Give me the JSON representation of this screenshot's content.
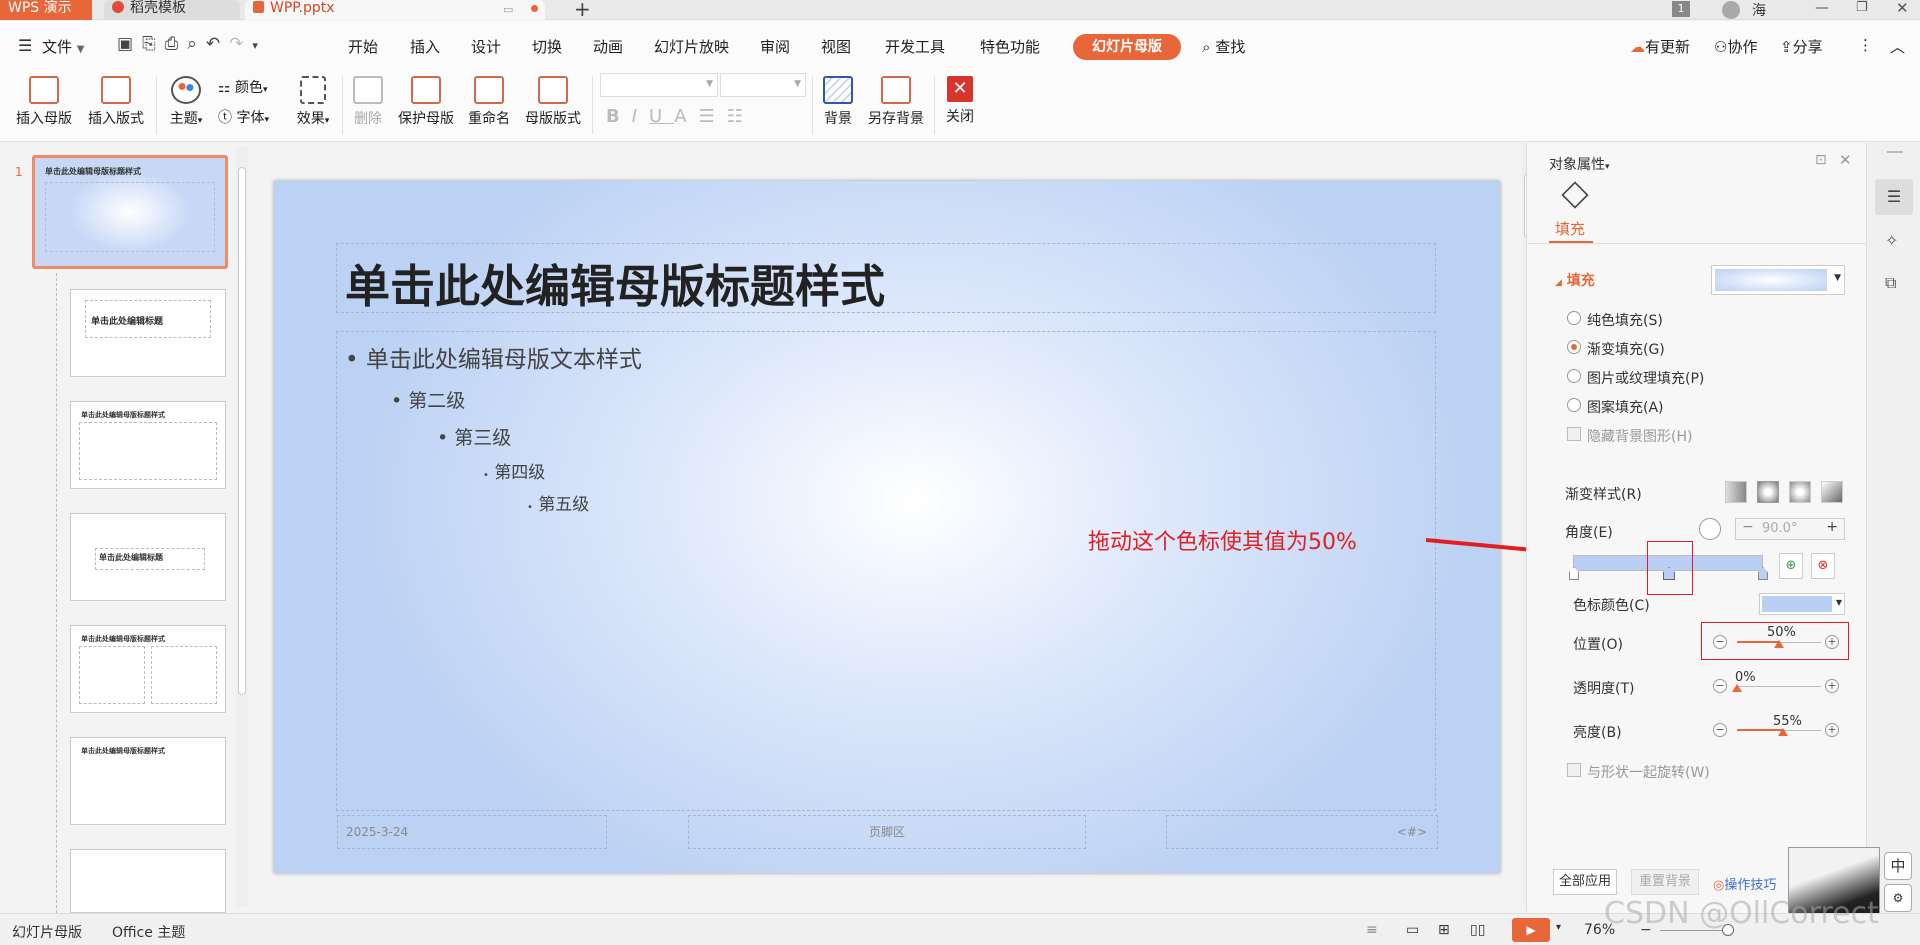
{
  "titlebar": {
    "app_tab": "WPS 演示",
    "template_tab": "稻壳模板",
    "file_tab": "WPP.pptx",
    "user_badge": "1",
    "user_name": "海"
  },
  "menu": {
    "file": "文件",
    "items": [
      "开始",
      "插入",
      "设计",
      "切换",
      "动画",
      "幻灯片放映",
      "审阅",
      "视图",
      "开发工具",
      "特色功能"
    ],
    "active_tab": "幻灯片母版",
    "search": "查找",
    "update": "有更新",
    "collab": "协作",
    "share": "分享"
  },
  "ribbon": {
    "insert_master": "插入母版",
    "insert_layout": "插入版式",
    "theme": "主题",
    "color": "颜色",
    "font": "字体",
    "effect": "效果",
    "delete": "删除",
    "protect_master": "保护母版",
    "rename": "重命名",
    "master_layout": "母版版式",
    "background": "背景",
    "save_background": "另存背景",
    "close": "关闭"
  },
  "thumbnails": {
    "slide_number": "1",
    "master_title": "单击此处编辑母版标题样式",
    "layout_title": "单击此处编辑标题"
  },
  "slide": {
    "title": "单击此处编辑母版标题样式",
    "levels": [
      "单击此处编辑母版文本样式",
      "第二级",
      "第三级",
      "第四级",
      "第五级"
    ],
    "footer_date": "2025-3-24",
    "footer_mid": "页脚区",
    "footer_num": "<#>"
  },
  "annotation": "拖动这个色标使其值为50%",
  "properties": {
    "header": "对象属性",
    "tab_fill": "填充",
    "section_fill": "填充",
    "solid": "纯色填充(S)",
    "gradient": "渐变填充(G)",
    "picture": "图片或纹理填充(P)",
    "pattern": "图案填充(A)",
    "hide_bg": "隐藏背景图形(H)",
    "gradient_style": "渐变样式(R)",
    "angle_label": "角度(E)",
    "angle_value": "90.0°",
    "stop_color_label": "色标颜色(C)",
    "position_label": "位置(O)",
    "position_value": "50%",
    "position_level": 0.5,
    "transparency_label": "透明度(T)",
    "transparency_value": "0%",
    "transparency_level": 0.0,
    "brightness_label": "亮度(B)",
    "brightness_value": "55%",
    "brightness_level": 0.55,
    "rotate_with_shape": "与形状一起旋转(W)",
    "apply_all": "全部应用",
    "reset_bg": "重置背景",
    "tips": "操作技巧",
    "accent": "#e8673a",
    "gradient_color": "#b9cff3"
  },
  "status": {
    "view_mode": "幻灯片母版",
    "theme": "Office 主题",
    "zoom": "76%",
    "ime": "中"
  },
  "watermark": "CSDN @OllCorrect"
}
